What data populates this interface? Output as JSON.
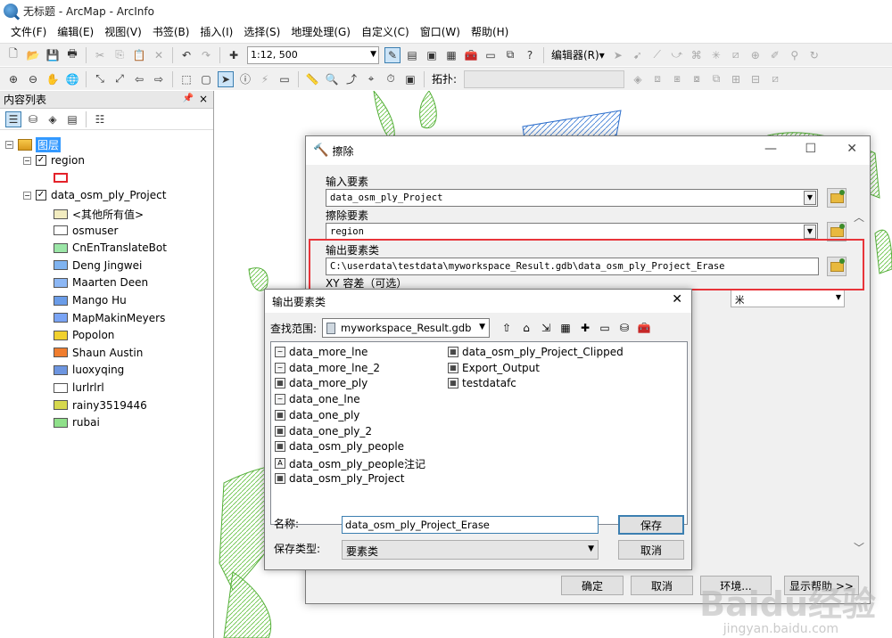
{
  "window": {
    "title": "无标题 - ArcMap - ArcInfo"
  },
  "menu": [
    "文件(F)",
    "编辑(E)",
    "视图(V)",
    "书签(B)",
    "插入(I)",
    "选择(S)",
    "地理处理(G)",
    "自定义(C)",
    "窗口(W)",
    "帮助(H)"
  ],
  "toolbar": {
    "scale": "1:12, 500",
    "editor_label": "编辑器(R)▾",
    "topology_label": "拓扑:"
  },
  "toc": {
    "title": "内容列表",
    "pin": "ꟷ",
    "close": "×",
    "root": "图层",
    "layer1": "region",
    "layer2": "data_osm_ply_Project",
    "values": [
      "<其他所有值>",
      "osmuser",
      "CnEnTranslateBot",
      "Deng Jingwei",
      "Maarten Deen",
      "Mango Hu",
      "MapMakinMeyers",
      "Popolon",
      "Shaun Austin",
      "luoxyqing",
      "lurlrlrl",
      "rainy3519446",
      "rubai"
    ],
    "colors": [
      "#f2ecc0",
      "#ffffff",
      "#9be6a7",
      "#7fb3f0",
      "#8cb7f5",
      "#6a9ce8",
      "#7aa4f5",
      "#f1d12e",
      "#f07d2e",
      "#6d95e0",
      "#ffffff",
      "#d6d84e",
      "#8fe08a"
    ]
  },
  "erase": {
    "title": "擦除",
    "input_label": "输入要素",
    "input_value": "data_osm_ply_Project",
    "erase_label": "擦除要素",
    "erase_value": "region",
    "output_label": "输出要素类",
    "output_value": "C:\\userdata\\testdata\\myworkspace_Result.gdb\\data_osm_ply_Project_Erase",
    "xy_label": "XY 容差（可选）",
    "unit": "米",
    "ok": "确定",
    "cancel": "取消",
    "apply": "环境...",
    "help": "显示帮助 >>"
  },
  "out": {
    "title": "输出要素类",
    "lookin_label": "查找范围:",
    "lookin_value": "myworkspace_Result.gdb",
    "files_left": [
      "data_more_lne",
      "data_more_lne_2",
      "data_more_ply",
      "data_one_lne",
      "data_one_ply",
      "data_one_ply_2",
      "data_osm_ply_people",
      "data_osm_ply_people注记",
      "data_osm_ply_Project"
    ],
    "files_right": [
      "data_osm_ply_Project_Clipped",
      "Export_Output",
      "testdatafc"
    ],
    "name_label": "名称:",
    "name_value": "data_osm_ply_Project_Erase",
    "type_label": "保存类型:",
    "type_value": "要素类",
    "save": "保存",
    "cancel": "取消"
  },
  "watermark": {
    "text": "Baidu经验",
    "url": "jingyan.baidu.com"
  }
}
